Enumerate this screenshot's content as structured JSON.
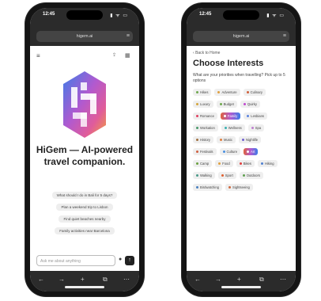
{
  "left": {
    "status": {
      "time": "12:45",
      "signals": "▮ ᯤ ▭"
    },
    "url": "higem.ai",
    "headline": "HiGem — AI-powered travel companion.",
    "suggestions": [
      "What should I do in Bali for 5 days?",
      "Plan a weekend trip to Lisbon",
      "Find quiet beaches nearby",
      "Family activities near Barcelona"
    ],
    "input_placeholder": "Ask me about anything",
    "send_icon": "↑",
    "mic_icon": "🎤"
  },
  "right": {
    "status": {
      "time": "12:45",
      "signals": "▮ ᯤ ▭"
    },
    "url": "higem.ai",
    "back": "Back to Home",
    "title": "Choose Interests",
    "subtitle": "What are your priorities when travelling? Pick up to 5 options",
    "rows": [
      [
        {
          "label": "Hikes",
          "color": "#6ea84e"
        },
        {
          "label": "Adventure",
          "color": "#e0a040"
        },
        {
          "label": "Culinary",
          "color": "#d0603a"
        }
      ],
      [
        {
          "label": "Luxury",
          "color": "#d4a43a"
        },
        {
          "label": "Budget",
          "color": "#6ea84e"
        },
        {
          "label": "Quirky",
          "color": "#c04ad0"
        }
      ],
      [
        {
          "label": "Romance",
          "color": "#e04060"
        },
        {
          "label": "Family",
          "color": "#ffffff",
          "highlight": true
        },
        {
          "label": "Lesbians",
          "color": "#5c84e0"
        }
      ],
      [
        {
          "label": "Workation",
          "color": "#4a9a6a"
        },
        {
          "label": "Wellness",
          "color": "#3ab0b0"
        },
        {
          "label": "Spa",
          "color": "#c080d0"
        }
      ],
      [
        {
          "label": "History",
          "color": "#a07040"
        },
        {
          "label": "Music",
          "color": "#e08040"
        },
        {
          "label": "Nightlife",
          "color": "#7060d0"
        }
      ],
      [
        {
          "label": "Festivals",
          "color": "#d06040"
        },
        {
          "label": "Culture",
          "color": "#4a90e0"
        },
        {
          "label": "Art",
          "color": "#ffffff",
          "highlight": true
        }
      ],
      [
        {
          "label": "Camp",
          "color": "#6aa040"
        },
        {
          "label": "Food",
          "color": "#e0a040"
        },
        {
          "label": "Bikes",
          "color": "#e04040"
        },
        {
          "label": "Hiking",
          "color": "#5080d0"
        }
      ],
      [
        {
          "label": "Walking",
          "color": "#4a9a8a"
        },
        {
          "label": "Sport",
          "color": "#e06030"
        },
        {
          "label": "Outdoors",
          "color": "#60a050"
        }
      ],
      [
        {
          "label": "Birdwatching",
          "color": "#4a80c0"
        },
        {
          "label": "Sightseeing",
          "color": "#d06a40"
        }
      ]
    ]
  },
  "nav_icons": [
    "←",
    "→",
    "+",
    "⧉",
    "⋯"
  ]
}
